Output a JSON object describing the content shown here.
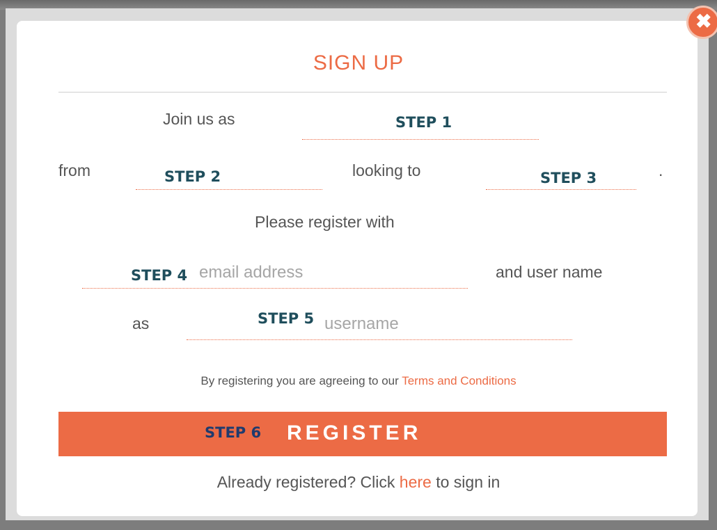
{
  "title": "SIGN UP",
  "close_icon": "close-icon",
  "sentence": {
    "join_us_as": "Join us as",
    "from": "from",
    "looking_to": "looking to",
    "period": ".",
    "please_register_with": "Please register with",
    "and_user_name": "and user name",
    "as": "as"
  },
  "steps": {
    "step1": "STEP 1",
    "step2": "STEP 2",
    "step3": "STEP 3",
    "step4": "STEP 4",
    "step5": "STEP 5",
    "step6": "STEP 6"
  },
  "fields": {
    "email_placeholder": "email address",
    "username_placeholder": "username"
  },
  "terms": {
    "prefix": "By registering you are agreeing to our ",
    "link": "Terms and Conditions"
  },
  "register_label": "REGISTER",
  "signin": {
    "prefix": "Already registered? Click ",
    "link": "here",
    "suffix": " to sign in"
  },
  "colors": {
    "accent": "#ec6b45",
    "step_text": "#1f4e5c"
  }
}
